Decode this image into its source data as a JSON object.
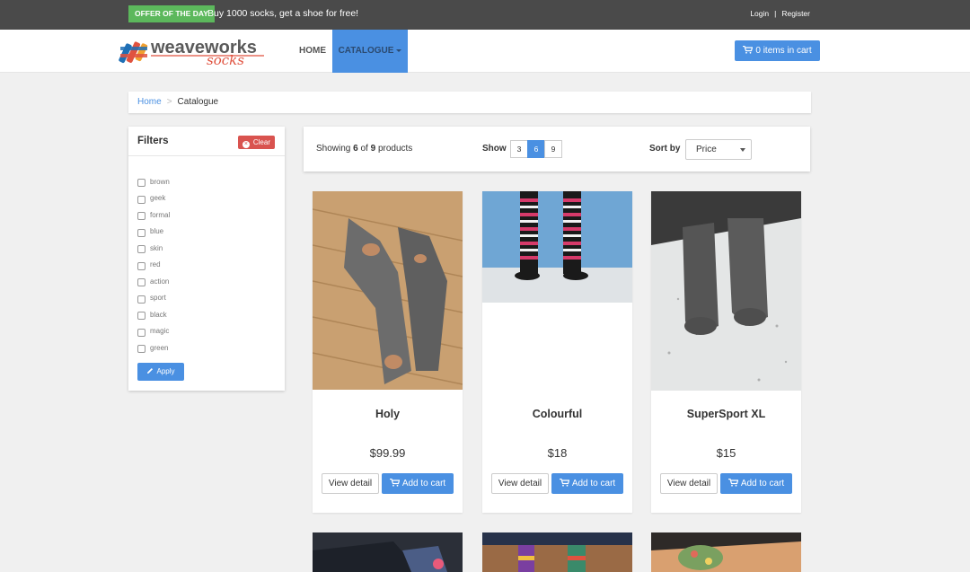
{
  "topbar": {
    "offer_badge": "OFFER OF THE DAY",
    "offer_text": "Buy 1000 socks, get a shoe for free!",
    "login": "Login",
    "separator": "|",
    "register": "Register"
  },
  "navbar": {
    "brand_main": "weaveworks",
    "brand_sub": "socks",
    "home": "HOME",
    "catalogue": "CATALOGUE",
    "cart": "0 items in cart"
  },
  "breadcrumb": {
    "home": "Home",
    "separator": ">",
    "current": "Catalogue"
  },
  "filters": {
    "title": "Filters",
    "clear": "Clear",
    "apply": "Apply",
    "items": [
      {
        "label": "brown"
      },
      {
        "label": "geek"
      },
      {
        "label": "formal"
      },
      {
        "label": "blue"
      },
      {
        "label": "skin"
      },
      {
        "label": "red"
      },
      {
        "label": "action"
      },
      {
        "label": "sport"
      },
      {
        "label": "black"
      },
      {
        "label": "magic"
      },
      {
        "label": "green"
      }
    ]
  },
  "toolbar": {
    "showing_prefix": "Showing ",
    "showing_count": "6",
    "showing_of": " of ",
    "showing_total": "9",
    "showing_suffix": " products",
    "show_label": "Show",
    "page_sizes": [
      "3",
      "6",
      "9"
    ],
    "active_page_size": "6",
    "sort_label": "Sort by",
    "sort_value": "Price"
  },
  "products": [
    {
      "name": "Holy",
      "price": "$99.99",
      "view": "View detail",
      "add": "Add to cart"
    },
    {
      "name": "Colourful",
      "price": "$18",
      "view": "View detail",
      "add": "Add to cart"
    },
    {
      "name": "SuperSport XL",
      "price": "$15",
      "view": "View detail",
      "add": "Add to cart"
    }
  ],
  "colors": {
    "accent": "#4a90e2",
    "offer": "#5cb85c",
    "clear": "#d9534f",
    "topbar": "#4a4a4a"
  }
}
